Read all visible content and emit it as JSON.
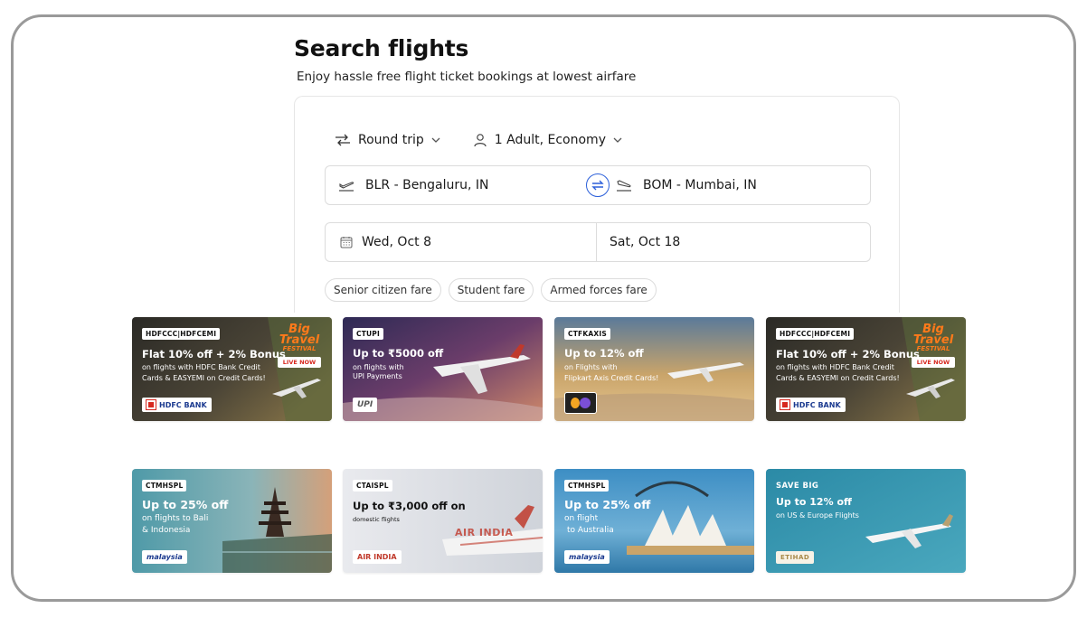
{
  "header": {
    "title": "Search flights",
    "subtitle": "Enjoy hassle free flight ticket bookings at lowest airfare"
  },
  "search": {
    "trip_type": "Round trip",
    "travellers": "1 Adult, Economy",
    "from": "BLR - Bengaluru, IN",
    "to": "BOM - Mumbai, IN",
    "depart_date": "Wed, Oct 8",
    "return_date": "Sat, Oct 18",
    "fare_types": [
      "Senior citizen fare",
      "Student fare",
      "Armed forces fare"
    ]
  },
  "offers": [
    {
      "code": "HDFCCC|HDFCEMI",
      "headline": "Flat 10% off + 2% Bonus",
      "sub1": "on flights with HDFC Bank Credit",
      "sub2": "Cards & EASYEMI on Credit Cards!",
      "logo": "HDFC BANK",
      "festival_1": "Big",
      "festival_2": "Travel",
      "festival_3": "FESTIVAL",
      "festival_live": "LIVE NOW"
    },
    {
      "code": "CTUPI",
      "headline": "Up to ₹5000 off",
      "sub1": "on flights with",
      "sub2": "UPI Payments",
      "logo": "UPI"
    },
    {
      "code": "CTFKAXIS",
      "headline": "Up to 12% off",
      "sub1": "on Flights with",
      "sub2": "Flipkart Axis Credit Cards!"
    },
    {
      "code": "HDFCCC|HDFCEMI",
      "headline": "Flat 10% off + 2% Bonus",
      "sub1": "on flights with HDFC Bank Credit",
      "sub2": "Cards & EASYEMI on Credit Cards!",
      "logo": "HDFC BANK",
      "festival_1": "Big",
      "festival_2": "Travel",
      "festival_3": "FESTIVAL",
      "festival_live": "LIVE NOW"
    },
    {
      "code": "CTMHSPL",
      "headline": "Up to 25% off",
      "sub1": "on flights to Bali",
      "sub2": "& Indonesia",
      "logo": "malaysia"
    },
    {
      "code": "CTAISPL",
      "headline": "Up to ₹3,000 off on",
      "sub1": "domestic flights",
      "logo": "AIR INDIA",
      "watermark": "AIR INDIA"
    },
    {
      "code": "CTMHSPL",
      "headline": "Up to 25% off",
      "sub1": "on flight",
      "sub2": "to Australia",
      "logo": "malaysia"
    },
    {
      "save_big": "SAVE BIG",
      "headline": "Up to 12% off",
      "sub1": "on US & Europe Flights",
      "logo": "ETIHAD"
    }
  ],
  "colors": {
    "swap_accent": "#2b5fd9",
    "text_primary": "#1a1a1a",
    "border": "#dcdcdc"
  }
}
